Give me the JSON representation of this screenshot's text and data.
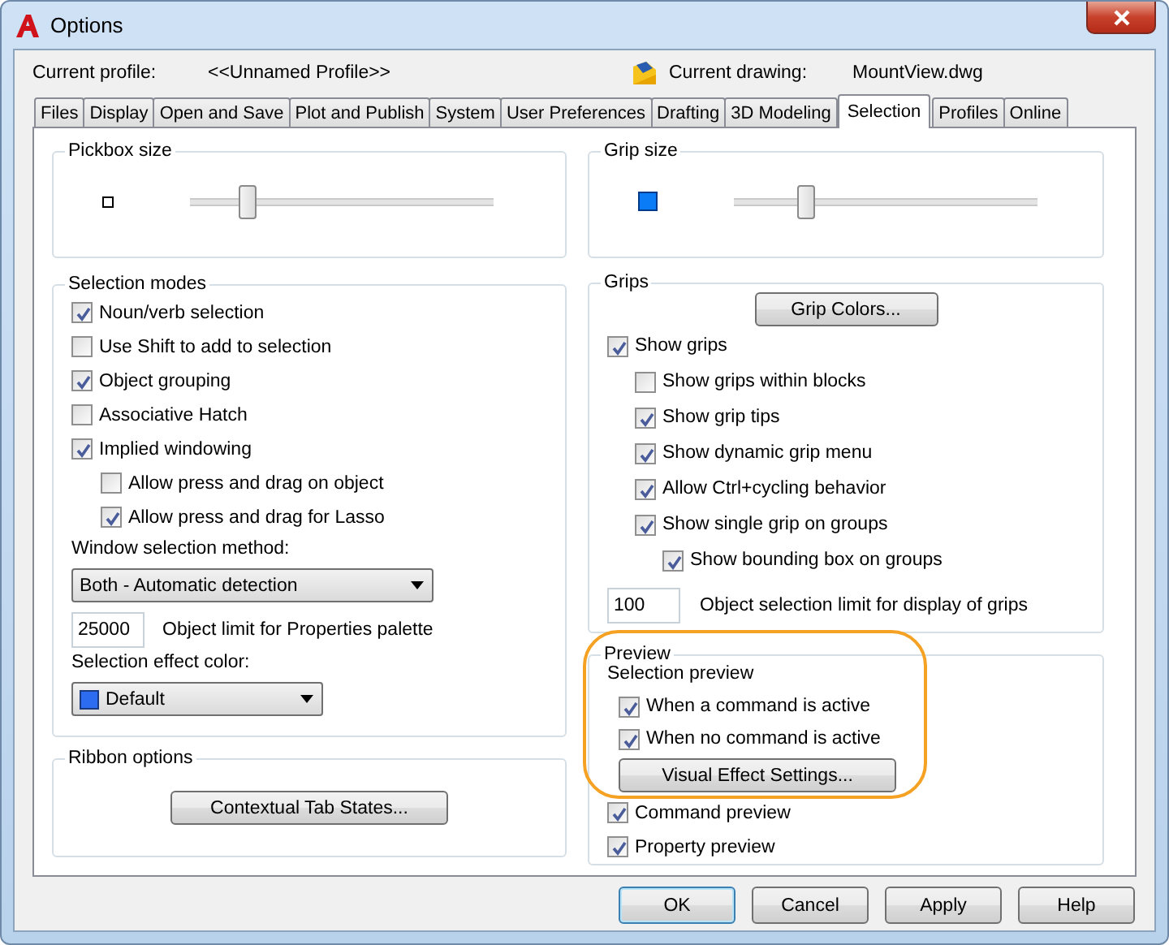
{
  "window": {
    "title": "Options"
  },
  "profile": {
    "label": "Current profile:",
    "value": "<<Unnamed Profile>>"
  },
  "drawing": {
    "label": "Current drawing:",
    "value": "MountView.dwg"
  },
  "tabs": [
    {
      "label": "Files",
      "selected": false
    },
    {
      "label": "Display",
      "selected": false
    },
    {
      "label": "Open and Save",
      "selected": false
    },
    {
      "label": "Plot and Publish",
      "selected": false
    },
    {
      "label": "System",
      "selected": false
    },
    {
      "label": "User Preferences",
      "selected": false
    },
    {
      "label": "Drafting",
      "selected": false
    },
    {
      "label": "3D Modeling",
      "selected": false
    },
    {
      "label": "Selection",
      "selected": true
    },
    {
      "label": "Profiles",
      "selected": false
    },
    {
      "label": "Online",
      "selected": false
    }
  ],
  "pickbox": {
    "title": "Pickbox size",
    "level": 0.17
  },
  "selection_modes": {
    "title": "Selection modes",
    "options": [
      {
        "label": "Noun/verb selection",
        "checked": true
      },
      {
        "label": "Use Shift to add to selection",
        "checked": false
      },
      {
        "label": "Object grouping",
        "checked": true
      },
      {
        "label": "Associative Hatch",
        "checked": false
      },
      {
        "label": "Implied windowing",
        "checked": true,
        "children": [
          {
            "label": "Allow press and drag on object",
            "checked": false
          },
          {
            "label": "Allow press and drag for Lasso",
            "checked": true
          }
        ]
      }
    ],
    "window_method": {
      "label": "Window selection method:",
      "value": "Both - Automatic detection"
    },
    "object_limit": {
      "value": "25000",
      "label": "Object limit for Properties palette"
    },
    "effect_color": {
      "label": "Selection effect color:",
      "value": "Default"
    }
  },
  "ribbon": {
    "title": "Ribbon options",
    "button": "Contextual Tab States..."
  },
  "grip_size": {
    "title": "Grip size",
    "level": 0.22
  },
  "grips": {
    "title": "Grips",
    "button": "Grip Colors...",
    "options": [
      {
        "label": "Show grips",
        "checked": true,
        "children": [
          {
            "label": "Show grips within blocks",
            "checked": false
          },
          {
            "label": "Show grip tips",
            "checked": true
          },
          {
            "label": "Show dynamic grip menu",
            "checked": true
          },
          {
            "label": "Allow Ctrl+cycling behavior",
            "checked": true
          },
          {
            "label": "Show single grip on groups",
            "checked": true,
            "children": [
              {
                "label": "Show bounding box on groups",
                "checked": true
              }
            ]
          }
        ]
      }
    ],
    "limit": {
      "value": "100",
      "label": "Object selection limit for display of grips"
    }
  },
  "preview": {
    "title": "Preview",
    "subtitle": "Selection preview",
    "options": [
      {
        "label": "When a command is active",
        "checked": true
      },
      {
        "label": "When no command is active",
        "checked": true
      }
    ],
    "button": "Visual Effect Settings...",
    "more": [
      {
        "label": "Command preview",
        "checked": true
      },
      {
        "label": "Property preview",
        "checked": true
      }
    ]
  },
  "buttons": [
    {
      "label": "OK",
      "default": true
    },
    {
      "label": "Cancel",
      "default": false
    },
    {
      "label": "Apply",
      "default": false
    },
    {
      "label": "Help",
      "default": false
    }
  ]
}
